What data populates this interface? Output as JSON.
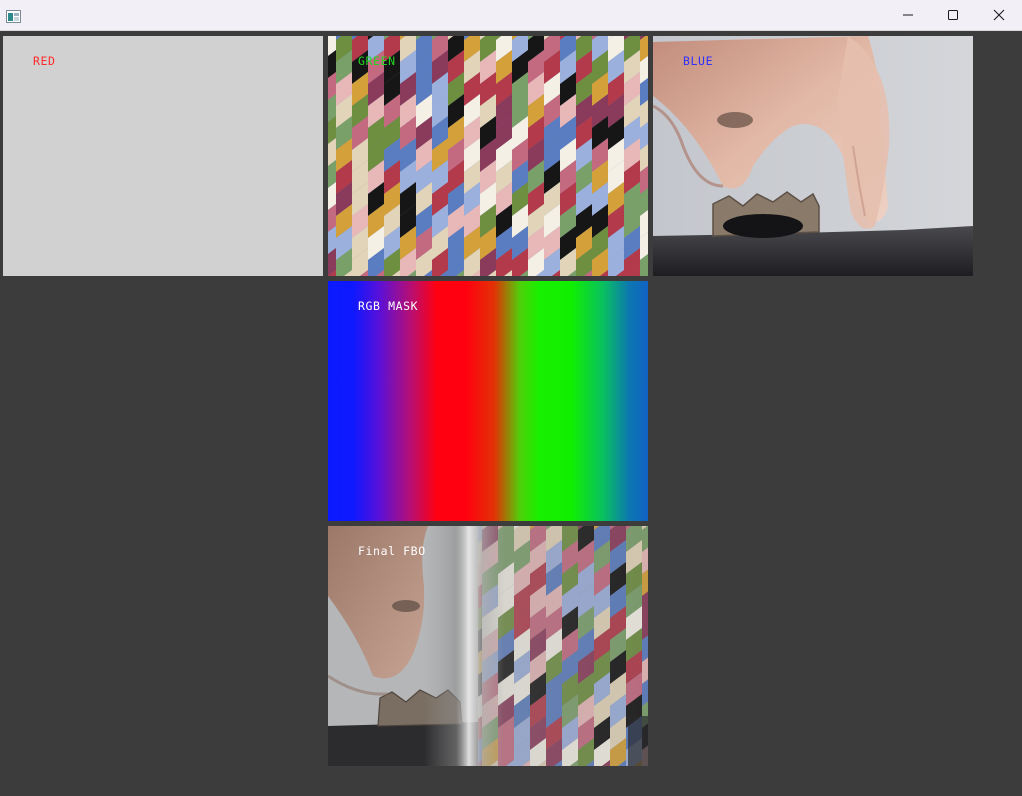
{
  "window": {
    "title": "",
    "icon": "app-window-icon",
    "controls": [
      "minimize-icon",
      "maximize-icon",
      "close-icon"
    ]
  },
  "panels": {
    "red": {
      "label": "RED",
      "label_color": "#ff2a2a"
    },
    "green": {
      "label": "GREEN",
      "label_color": "#22d622"
    },
    "blue": {
      "label": "BLUE",
      "label_color": "#3030ff"
    },
    "mask": {
      "label": "RGB MASK",
      "label_color": "#ffffff"
    },
    "final": {
      "label": "Final FBO",
      "label_color": "#ffffff"
    }
  },
  "colors": {
    "background": "#3c3c3c",
    "titlebar": "#f3eff7",
    "red_panel_fill": "#d1d1d1",
    "stripe_palette": [
      "#5a7cc0",
      "#9bb0dc",
      "#7aa06a",
      "#c46a80",
      "#b23a4a",
      "#e2d4b8",
      "#f4f0e6",
      "#d4a03a",
      "#161616",
      "#8a3a5a",
      "#e8b8b8",
      "#6e8e40"
    ]
  }
}
